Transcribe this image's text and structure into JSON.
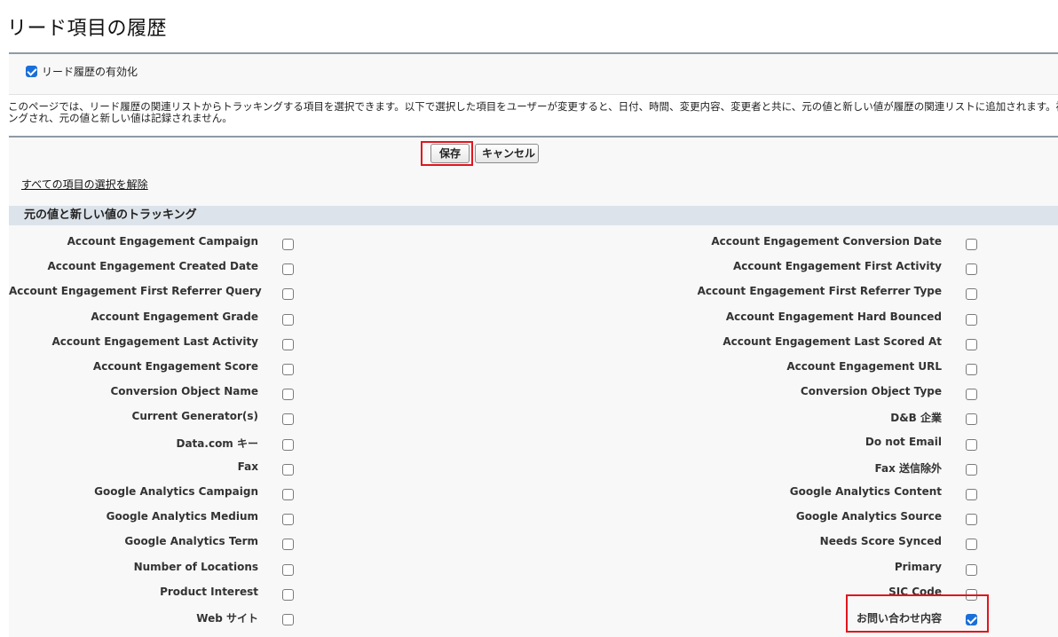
{
  "page": {
    "title": "リード項目の履歴",
    "enable_label": "リード履歴の有効化",
    "enable_checked": true,
    "description_line1": "このページでは、リード履歴の関連リストからトラッキングする項目を選択できます。以下で選択した項目をユーザーが変更すると、日付、時間、変更内容、変更者と共に、元の値と新しい値が履歴の関連リストに追加されます。複数選択",
    "description_line2": "ングされ、元の値と新しい値は記録されません。"
  },
  "toolbar": {
    "save_label": "保存",
    "cancel_label": "キャンセル"
  },
  "deselect_all_label": "すべての項目の選択を解除",
  "section_title": "元の値と新しい値のトラッキング",
  "fields": [
    {
      "left": "Account Engagement Campaign",
      "right": "Account Engagement Conversion Date",
      "left_checked": false,
      "right_checked": false
    },
    {
      "left": "Account Engagement Created Date",
      "right": "Account Engagement First Activity",
      "left_checked": false,
      "right_checked": false
    },
    {
      "left": "Account Engagement First Referrer Query",
      "right": "Account Engagement First Referrer Type",
      "left_checked": false,
      "right_checked": false
    },
    {
      "left": "Account Engagement Grade",
      "right": "Account Engagement Hard Bounced",
      "left_checked": false,
      "right_checked": false
    },
    {
      "left": "Account Engagement Last Activity",
      "right": "Account Engagement Last Scored At",
      "left_checked": false,
      "right_checked": false
    },
    {
      "left": "Account Engagement Score",
      "right": "Account Engagement URL",
      "left_checked": false,
      "right_checked": false
    },
    {
      "left": "Conversion Object Name",
      "right": "Conversion Object Type",
      "left_checked": false,
      "right_checked": false
    },
    {
      "left": "Current Generator(s)",
      "right": "D&B 企業",
      "left_checked": false,
      "right_checked": false
    },
    {
      "left": "Data.com キー",
      "right": "Do not Email",
      "left_checked": false,
      "right_checked": false
    },
    {
      "left": "Fax",
      "right": "Fax 送信除外",
      "left_checked": false,
      "right_checked": false
    },
    {
      "left": "Google Analytics Campaign",
      "right": "Google Analytics Content",
      "left_checked": false,
      "right_checked": false
    },
    {
      "left": "Google Analytics Medium",
      "right": "Google Analytics Source",
      "left_checked": false,
      "right_checked": false
    },
    {
      "left": "Google Analytics Term",
      "right": "Needs Score Synced",
      "left_checked": false,
      "right_checked": false
    },
    {
      "left": "Number of Locations",
      "right": "Primary",
      "left_checked": false,
      "right_checked": false
    },
    {
      "left": "Product Interest",
      "right": "SIC Code",
      "left_checked": false,
      "right_checked": false
    },
    {
      "left": "Web サイト",
      "right": "お問い合わせ内容",
      "left_checked": false,
      "right_checked": true
    }
  ]
}
